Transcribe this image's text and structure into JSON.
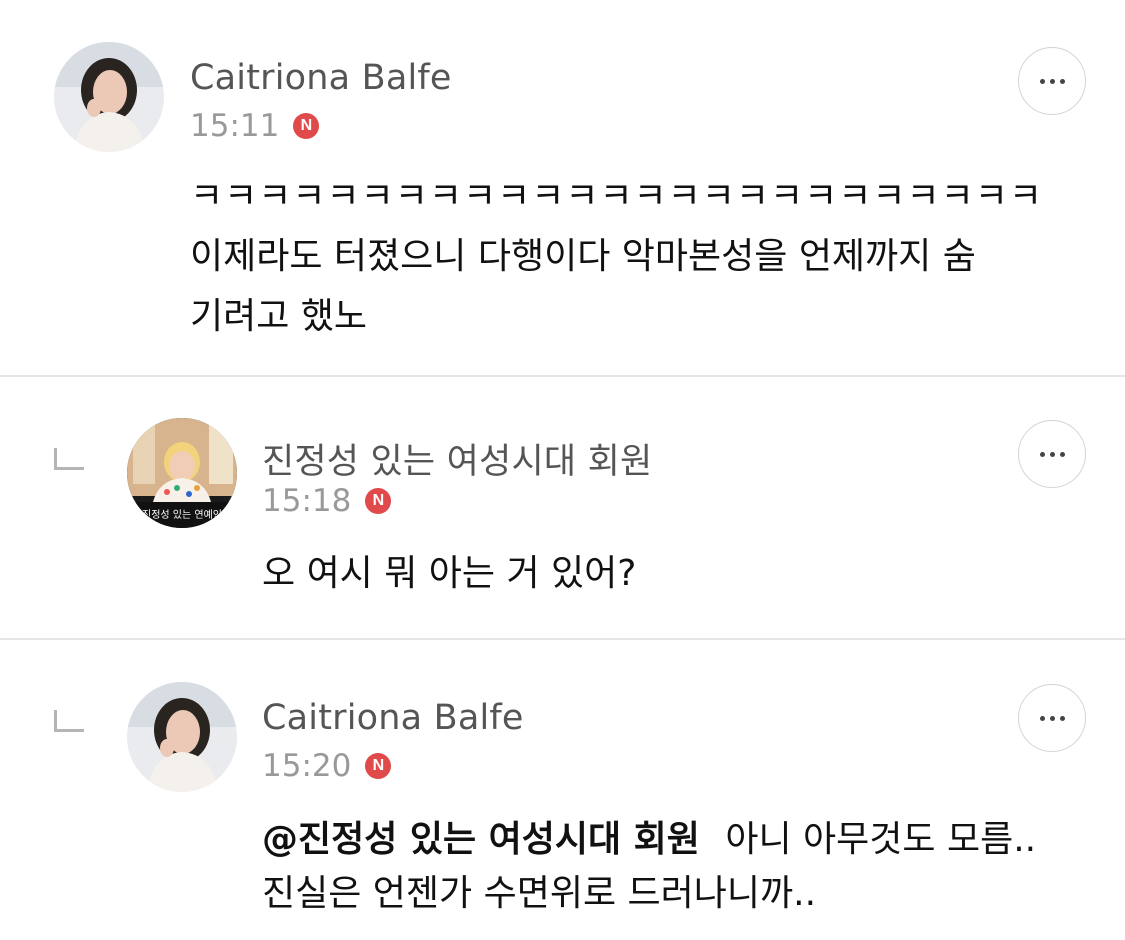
{
  "comments": [
    {
      "author": "Caitriona Balfe",
      "time": "15:11",
      "badge": "N",
      "lines": [
        "ㅋㅋㅋㅋㅋㅋㅋㅋㅋㅋㅋㅋㅋㅋㅋㅋㅋㅋㅋㅋㅋㅋㅋㅋㅋ",
        "이제라도 터졌으니 다행이다 악마본성을 언제까지 숨",
        "기려고 했노"
      ]
    },
    {
      "author": "진정성 있는 여성시대 회원",
      "time": "15:18",
      "badge": "N",
      "avatar_caption": "진정성 있는 연예인",
      "lines": [
        "오 여시 뭐 아는 거 있어?"
      ]
    },
    {
      "author": "Caitriona Balfe",
      "time": "15:20",
      "badge": "N",
      "mention": "@진정성 있는 여성시대 회원",
      "line1_rest": "아니 아무것도 모름..",
      "line2": "진실은 언젠가 수면위로 드러나니까.."
    }
  ],
  "colors": {
    "badge": "#e04a4a",
    "divider": "#e6e6e6",
    "meta": "#999999"
  },
  "icons": {
    "more": "more-horizontal-icon",
    "reply": "reply-indent-icon"
  }
}
